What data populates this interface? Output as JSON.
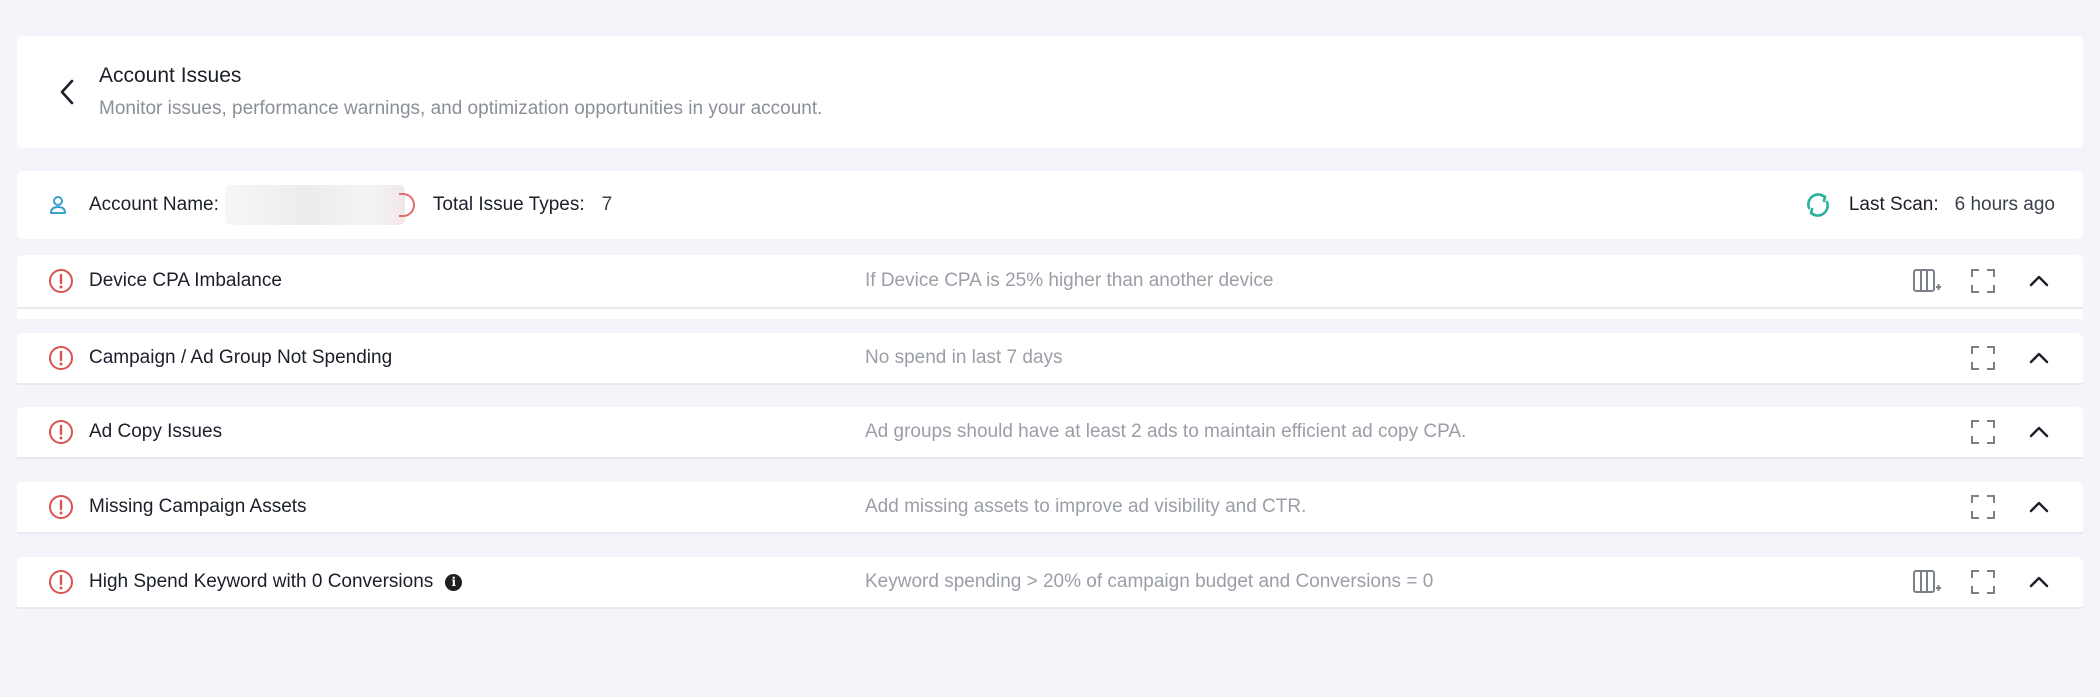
{
  "header": {
    "title": "Account Issues",
    "subtitle": "Monitor issues, performance warnings, and optimization opportunities in your account."
  },
  "account": {
    "name_label": "Account Name:",
    "issue_types_label": "Total Issue Types:",
    "issue_types_count": "7",
    "last_scan_label": "Last Scan:",
    "last_scan_value": "6 hours ago"
  },
  "issues": [
    {
      "title": "Device CPA Imbalance",
      "description": "If Device CPA is 25% higher than another device"
    },
    {
      "title": "Campaign / Ad Group Not Spending",
      "description": "No spend in last 7 days"
    },
    {
      "title": "Ad Copy Issues",
      "description": "Ad groups should have at least 2 ads to maintain efficient ad copy CPA."
    },
    {
      "title": "Missing Campaign Assets",
      "description": "Add missing assets to improve ad visibility and CTR."
    },
    {
      "title": "High Spend Keyword with 0 Conversions",
      "description": "Keyword spending > 20% of campaign budget and Conversions = 0"
    }
  ],
  "colors": {
    "alert": "#d9534f",
    "accent_teal": "#2bb39a",
    "person_icon": "#3aa0c8",
    "icon_gray": "#7c8089"
  },
  "icons": {
    "back": "chevron-left-icon",
    "person": "person-icon",
    "refresh": "refresh-icon",
    "alert": "alert-circle-icon",
    "columns": "add-column-icon",
    "expand": "fullscreen-icon",
    "collapse": "chevron-up-icon",
    "info": "info-icon"
  }
}
